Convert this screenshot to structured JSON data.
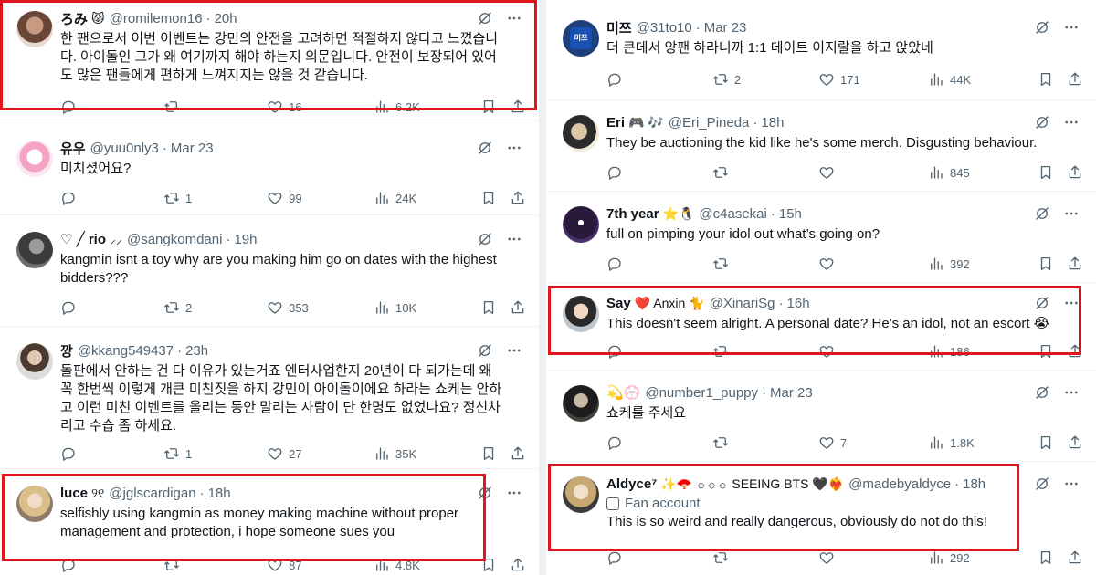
{
  "colors": {
    "highlight": "#e0151d",
    "text": "#0f1419",
    "muted": "#536471"
  },
  "icons": {
    "reply": "reply-icon",
    "retweet": "retweet-icon",
    "like": "heart-icon",
    "views": "views-chart-icon",
    "bookmark": "bookmark-icon",
    "share": "share-icon",
    "grok": "grok-icon",
    "more": "more-icon"
  },
  "left": [
    {
      "name": "ろみ",
      "emoji": "😾",
      "handle": "@romilemon16",
      "time": "20h",
      "text": "한 팬으로서 이번 이벤트는 강민의 안전을 고려하면 적절하지 않다고 느꼈습니\n다. 아이돌인 그가 왜 여기까지 해야 하는지 의문입니다. 안전이 보장되어 있어\n도 많은 팬들에게 편하게 느껴지지는 않을 것 같습니다.",
      "reply": "",
      "retweets": "",
      "likes": "16",
      "views": "6.2K"
    },
    {
      "name": "유우",
      "emoji": "",
      "handle": "@yuu0nly3",
      "time": "Mar 23",
      "text": "미치셨어요?",
      "reply": "",
      "retweets": "1",
      "likes": "99",
      "views": "24K"
    },
    {
      "name": "♡ ╱ rio",
      "emoji": "⸝⸝",
      "handle": "@sangkomdani",
      "time": "19h",
      "text": "kangmin isnt a toy why are you making him go on dates with the highest\nbidders???",
      "reply": "",
      "retweets": "2",
      "likes": "353",
      "views": "10K"
    },
    {
      "name": "깡",
      "emoji": "",
      "handle": "@kkang549437",
      "time": "23h",
      "text": "돌판에서 안하는 건 다 이유가 있는거죠 엔터사업한지 20년이 다 되가는데 왜\n꼭 한번씩 이렇게 개큰 미친짓을 하지 강민이 아이돌이에요 하라는 쇼케는 안하\n고 이런 미친 이벤트를 올리는 동안 말리는 사람이 단 한명도 없었나요? 정신차\n리고 수습 좀 하세요.",
      "reply": "",
      "retweets": "1",
      "likes": "27",
      "views": "35K"
    },
    {
      "name": "luce",
      "emoji": "୨୧",
      "handle": "@jglscardigan",
      "time": "18h",
      "text": "selfishly using kangmin as money making machine without proper\nmanagement and protection, i hope someone sues you",
      "reply": "",
      "retweets": "",
      "likes": "87",
      "views": "4.8K"
    }
  ],
  "right": [
    {
      "name": "미쯔",
      "emoji": "",
      "handle": "@31to10",
      "time": "Mar 23",
      "avatar_text": "미쯔",
      "text": "더 큰데서 앙팬 하라니까 1:1 데이트 이지랄을 하고 앉았네",
      "reply": "",
      "retweets": "2",
      "likes": "171",
      "views": "44K"
    },
    {
      "name": "Eri",
      "emoji": "🎮 🎶",
      "handle": "@Eri_Pineda",
      "time": "18h",
      "text": "They be auctioning the kid like he's some merch. Disgusting behaviour.",
      "reply": "",
      "retweets": "",
      "likes": "",
      "views": "845"
    },
    {
      "name": "7th year",
      "emoji": "⭐🐧",
      "handle": "@c4asekai",
      "time": "15h",
      "text": "full on pimping your idol out what’s going on?",
      "reply": "",
      "retweets": "",
      "likes": "",
      "views": "392"
    },
    {
      "name": "Say",
      "emoji": "❤️ Anxin 🐈",
      "handle": "@XinariSg",
      "time": "16h",
      "text": "This doesn't seem alright. A personal date? He's an idol, not an escort 😭",
      "reply": "",
      "retweets": "",
      "likes": "",
      "views": "186"
    },
    {
      "name": "💫💮",
      "emoji": "",
      "handle": "@number1_puppy",
      "time": "Mar 23",
      "text": "쇼케를 주세요",
      "reply": "",
      "retweets": "",
      "likes": "7",
      "views": "1.8K"
    },
    {
      "name": "Aldyce⁷",
      "emoji": "✨🪭 ⦵⦵⦵ SEEING BTS 🖤❤️‍🔥",
      "handle": "@madebyaldyce",
      "time": "18h",
      "badge": "Fan account",
      "text": "This is so weird and really dangerous, obviously do not do this!",
      "reply": "",
      "retweets": "",
      "likes": "",
      "views": "292"
    }
  ]
}
